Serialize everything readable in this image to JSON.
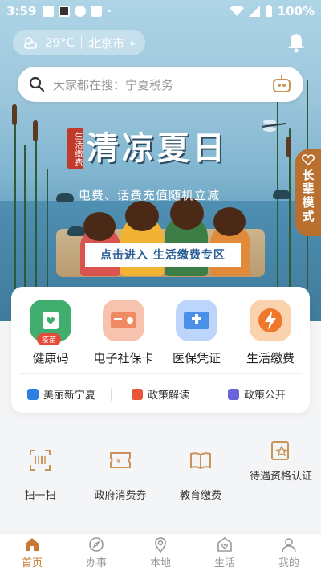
{
  "status_bar": {
    "time": "3:59",
    "battery": "100%"
  },
  "header": {
    "temperature": "29°C",
    "city": "北京市",
    "city_arrow": "▸"
  },
  "search": {
    "placeholder": "大家都在搜：宁夏税务"
  },
  "banner": {
    "tag": "生活缴费",
    "title": "清凉夏日",
    "subtitle": "电费、话费充值随机立减",
    "cta": "点击进入 生活缴费专区",
    "elder_mode": "长辈模式"
  },
  "services": [
    {
      "label": "健康码",
      "badge": "疫苗",
      "color": "#3fae6e"
    },
    {
      "label": "电子社保卡",
      "color": "#f08a62"
    },
    {
      "label": "医保凭证",
      "color": "#4a8fe8"
    },
    {
      "label": "生活缴费",
      "color": "#f0782a"
    }
  ],
  "links": [
    {
      "label": "美丽新宁夏",
      "color": "#2f7fe0"
    },
    {
      "label": "政策解读",
      "color": "#e8553a"
    },
    {
      "label": "政策公开",
      "color": "#6a63d9"
    }
  ],
  "grid": [
    {
      "label": "扫一扫",
      "icon": "scan-icon"
    },
    {
      "label": "政府消费券",
      "icon": "voucher-icon"
    },
    {
      "label": "教育缴费",
      "icon": "book-icon"
    },
    {
      "label": "待遇资格认证",
      "icon": "certificate-icon"
    }
  ],
  "tabs": [
    {
      "label": "首页",
      "icon": "home-icon",
      "active": true
    },
    {
      "label": "办事",
      "icon": "compass-icon"
    },
    {
      "label": "本地",
      "icon": "location-icon"
    },
    {
      "label": "生活",
      "icon": "life-icon"
    },
    {
      "label": "我的",
      "icon": "profile-icon"
    }
  ],
  "colors": {
    "accent": "#c77a33",
    "grid_icon": "#c9935a"
  }
}
